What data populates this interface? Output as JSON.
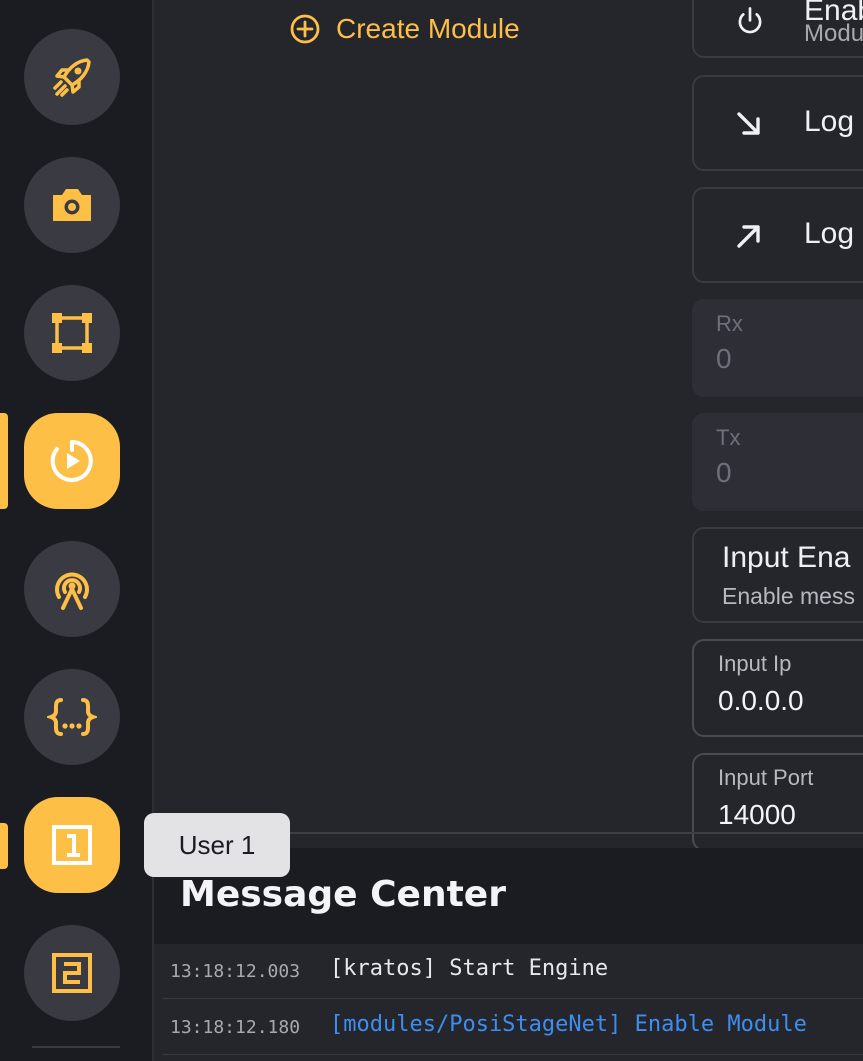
{
  "sidebar": {
    "items": [
      {
        "icon": "rocket-icon",
        "active": false
      },
      {
        "icon": "camera-icon",
        "active": false
      },
      {
        "icon": "frame-icon",
        "active": false
      },
      {
        "icon": "timer-play-icon",
        "active": true
      },
      {
        "icon": "broadcast-icon",
        "active": false
      },
      {
        "icon": "braces-icon",
        "active": false
      },
      {
        "icon": "user-1-icon",
        "active": true,
        "tooltip": "User 1"
      },
      {
        "icon": "user-2-icon",
        "active": false
      }
    ]
  },
  "main": {
    "create_module_label": "Create Module",
    "module_panel": {
      "enable_card": {
        "label": "Enab",
        "sub": "Modu"
      },
      "log_in_card": {
        "label": "Log"
      },
      "log_out_card": {
        "label": "Log"
      },
      "rx": {
        "label": "Rx",
        "value": "0"
      },
      "tx": {
        "label": "Tx",
        "value": "0"
      },
      "input_enable": {
        "title": "Input Ena",
        "sub": "Enable mess"
      },
      "input_ip": {
        "label": "Input Ip",
        "value": "0.0.0.0"
      },
      "input_port": {
        "label": "Input Port",
        "value": "14000"
      }
    }
  },
  "tooltip": {
    "text": "User 1"
  },
  "message_center": {
    "title": "Message Center",
    "messages": [
      {
        "timestamp": "13:18:12.003",
        "text": "[kratos] Start Engine",
        "color": "#e8e8ec"
      },
      {
        "timestamp": "13:18:12.180",
        "text": "[modules/PosiStageNet] Enable Module",
        "color": "#3d8ef0"
      }
    ]
  },
  "colors": {
    "accent": "#fdbf46",
    "background": "#25262c",
    "sidebar": "#1b1c21",
    "link": "#3d8ef0"
  }
}
